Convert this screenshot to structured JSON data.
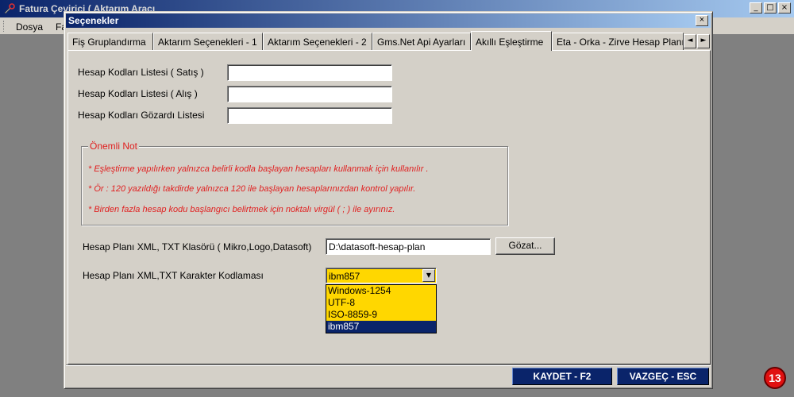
{
  "app": {
    "title": "Fatura Çevirici ( Aktarım Aracı",
    "menu": [
      "Dosya",
      "Fa"
    ],
    "controls": {
      "minimize": "_",
      "maximize": "□",
      "close": "×"
    },
    "badge": "13"
  },
  "dialog": {
    "title": "Seçenekler",
    "close": "×",
    "tabs": [
      {
        "label": "Fiş Gruplandırma"
      },
      {
        "label": "Aktarım Seçenekleri - 1"
      },
      {
        "label": "Aktarım Seçenekleri - 2"
      },
      {
        "label": "Gms.Net Api Ayarları"
      },
      {
        "label": "Akıllı Eşleştirme"
      },
      {
        "label": "Eta - Orka - Zirve Hesap Planı"
      }
    ],
    "tab_scroll": {
      "left": "◄",
      "right": "►"
    },
    "fields": [
      {
        "label": "Hesap Kodları Listesi ( Satış )",
        "value": ""
      },
      {
        "label": "Hesap Kodları Listesi ( Alış )",
        "value": ""
      },
      {
        "label": "Hesap Kodları Gözardı Listesi",
        "value": ""
      }
    ],
    "note_group": {
      "title": "Önemli Not",
      "lines": [
        "* Eşleştirme yapılırken yalnızca belirli kodla başlayan hesapları kullanmak için kullanılır .",
        "* Ör : 120 yazıldığı takdirde yalnızca 120 ile başlayan hesaplarınızdan kontrol yapılır.",
        "* Birden fazla hesap kodu başlangıcı belirtmek için noktalı virgül ( ; ) ile ayırınız."
      ]
    },
    "folder": {
      "label": "Hesap Planı XML, TXT Klasörü ( Mikro,Logo,Datasoft)",
      "value": "D:\\datasoft-hesap-plan",
      "browse_label": "Gözat..."
    },
    "encoding": {
      "label": "Hesap Planı XML,TXT Karakter Kodlaması",
      "selected": "ibm857",
      "arrow": "▼",
      "options": [
        "Windows-1254",
        "UTF-8",
        "ISO-8859-9",
        "ibm857"
      ],
      "selected_index": 3
    },
    "save_label": "KAYDET - F2",
    "cancel_label": "VAZGEÇ - ESC"
  },
  "colors": {
    "title_gradient_start": "#0a246a",
    "title_gradient_end": "#a6caf0",
    "note_red": "#e02020",
    "combo_yellow": "#ffd700",
    "selection_navy": "#0a246a"
  }
}
